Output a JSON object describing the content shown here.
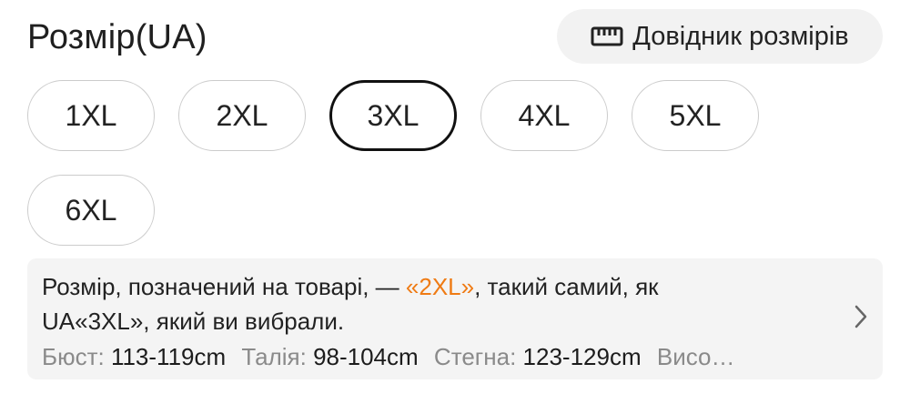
{
  "header": {
    "title": "Розмір(UA)",
    "guide_button": {
      "label": "Довідник розмірів",
      "icon": "ruler-icon"
    }
  },
  "sizes": [
    {
      "label": "1XL",
      "selected": false
    },
    {
      "label": "2XL",
      "selected": false
    },
    {
      "label": "3XL",
      "selected": true
    },
    {
      "label": "4XL",
      "selected": false
    },
    {
      "label": "5XL",
      "selected": false
    },
    {
      "label": "6XL",
      "selected": false
    }
  ],
  "info": {
    "text_before": "Розмір, позначений на товарі, — ",
    "highlight": "«2XL»",
    "text_after": ", такий самий, як",
    "line2": "UA«3XL», який ви вибрали.",
    "measurements": [
      {
        "label": "Бюст:",
        "value": "113-119cm"
      },
      {
        "label": "Талія:",
        "value": "98-104cm"
      },
      {
        "label": "Стегна:",
        "value": "123-129cm"
      },
      {
        "label": "Висо…",
        "value": ""
      }
    ],
    "chevron_icon": "chevron-right-icon"
  },
  "colors": {
    "highlight": "#ef7b14",
    "selected_border": "#111111",
    "chip_border": "#cccccc",
    "info_bg": "#f4f4f4"
  }
}
